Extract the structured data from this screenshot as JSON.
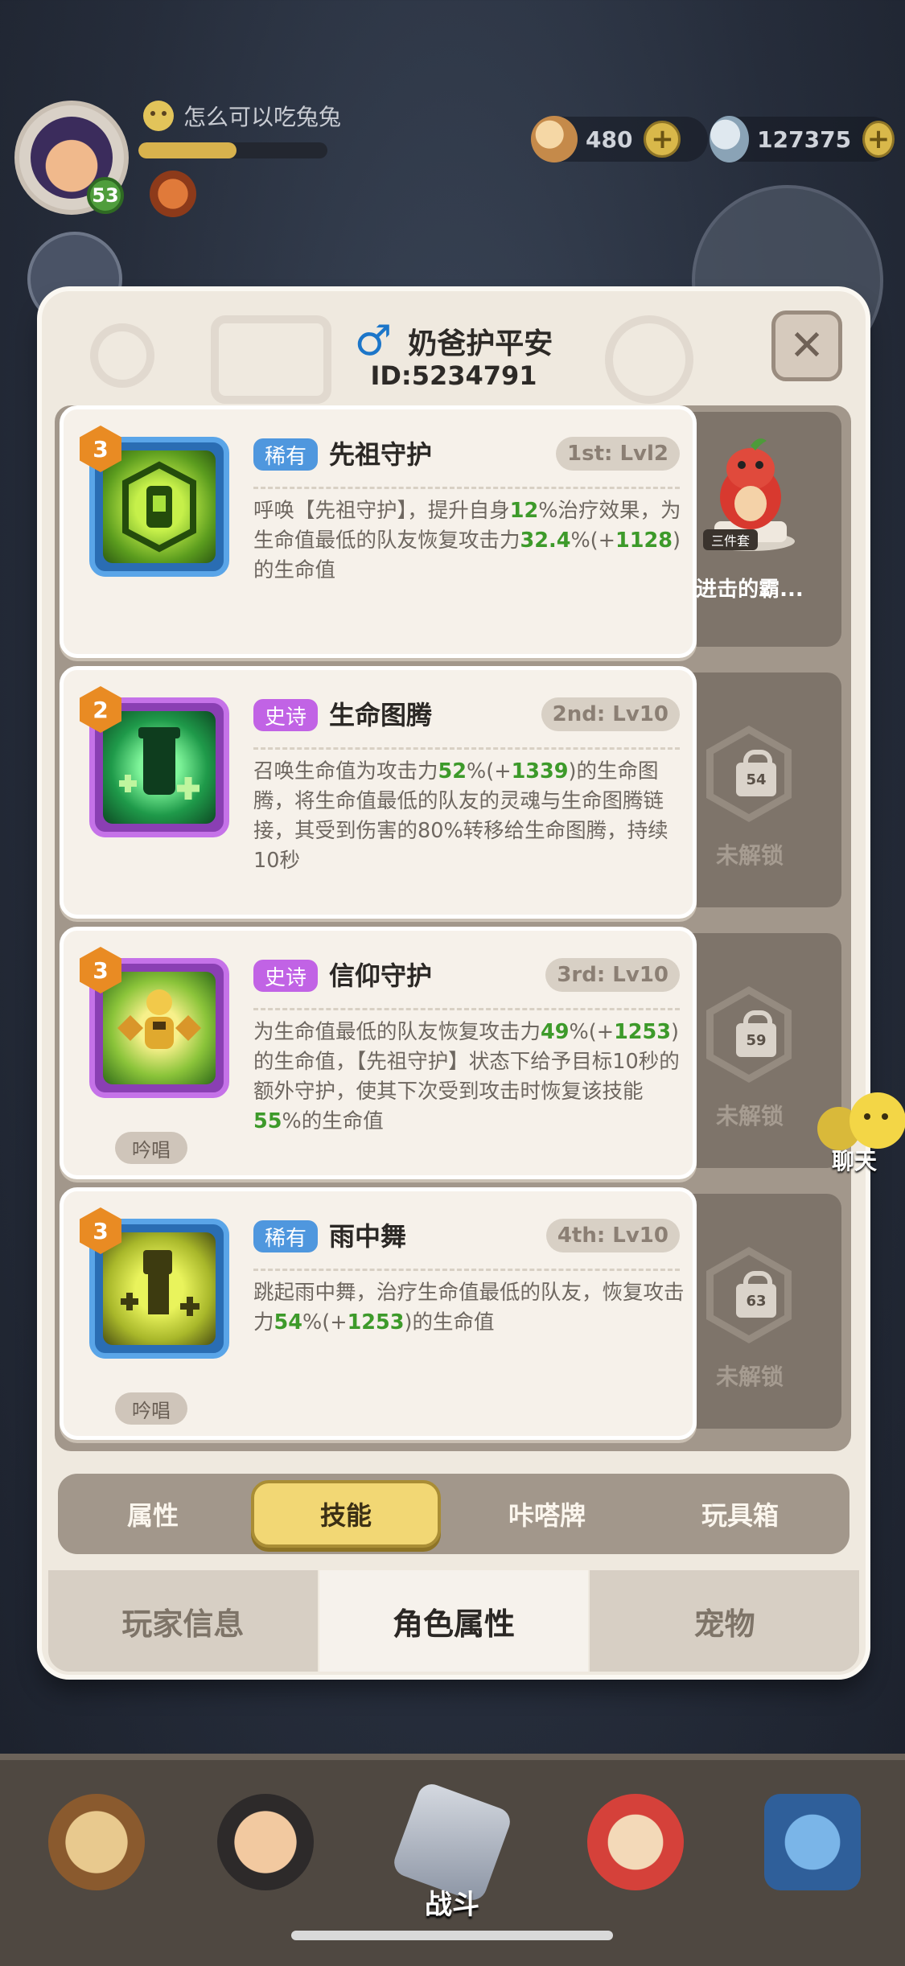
{
  "hud": {
    "username": "怎么可以吃兔兔",
    "level": "53",
    "xp_fraction": 0.52,
    "resources": [
      {
        "icon": "shell-icon",
        "value": "480"
      },
      {
        "icon": "pearl-icon",
        "value": "127375"
      }
    ],
    "plus_label": "+"
  },
  "modal": {
    "gender_icon": "♂",
    "player_name": "奶爸护平安",
    "player_id": "ID:5234791",
    "close_label": "✕",
    "set_item": {
      "badge": "三件套",
      "name": "进击的霸..."
    },
    "skills": [
      {
        "tier": "3",
        "rarity": "稀有",
        "name": "先祖守护",
        "level": "1st: Lvl2",
        "desc_html_parts": [
          [
            "t",
            "呼唤【先祖守护】，提升自身"
          ],
          [
            "g",
            "12"
          ],
          [
            "t",
            "%治疗效果，为生命值最低的队友恢复攻击力"
          ],
          [
            "g",
            "32.4"
          ],
          [
            "t",
            "%(+"
          ],
          [
            "g",
            "1128"
          ],
          [
            "t",
            ")的生命值"
          ]
        ],
        "chant": ""
      },
      {
        "tier": "2",
        "rarity": "史诗",
        "name": "生命图腾",
        "level": "2nd: Lv10",
        "desc_html_parts": [
          [
            "t",
            "召唤生命值为攻击力"
          ],
          [
            "g",
            "52"
          ],
          [
            "t",
            "%(+"
          ],
          [
            "g",
            "1339"
          ],
          [
            "t",
            ")的生命图腾，将生命值最低的队友的灵魂与生命图腾链接，其受到伤害的80%转移给生命图腾，持续10秒"
          ]
        ],
        "chant": "",
        "lock": {
          "level": "54",
          "text": "未解锁"
        }
      },
      {
        "tier": "3",
        "rarity": "史诗",
        "name": "信仰守护",
        "level": "3rd: Lv10",
        "desc_html_parts": [
          [
            "t",
            "为生命值最低的队友恢复攻击力"
          ],
          [
            "g",
            "49"
          ],
          [
            "t",
            "%(+"
          ],
          [
            "g",
            "1253"
          ],
          [
            "t",
            ")的生命值，【先祖守护】状态下给予目标10秒的额外守护，使其下次受到攻击时恢复该技能"
          ],
          [
            "g",
            "55"
          ],
          [
            "t",
            "%的生命值"
          ]
        ],
        "chant": "吟唱",
        "lock": {
          "level": "59",
          "text": "未解锁"
        }
      },
      {
        "tier": "3",
        "rarity": "稀有",
        "name": "雨中舞",
        "level": "4th: Lv10",
        "desc_html_parts": [
          [
            "t",
            "跳起雨中舞，治疗生命值最低的队友，恢复攻击力"
          ],
          [
            "g",
            "54"
          ],
          [
            "t",
            "%(+"
          ],
          [
            "g",
            "1253"
          ],
          [
            "t",
            ")的生命值"
          ]
        ],
        "chant": "吟唱",
        "lock": {
          "level": "63",
          "text": "未解锁"
        }
      }
    ],
    "inner_tabs": [
      "属性",
      "技能",
      "咔嗒牌",
      "玩具箱"
    ],
    "inner_tab_active": 1,
    "outer_tabs": [
      "玩家信息",
      "角色属性",
      "宠物"
    ],
    "outer_tab_active": 1
  },
  "chat_label": "聊天",
  "bottom_nav": {
    "battle_label": "战斗"
  },
  "colors": {
    "accent_yellow": "#f2d774",
    "number_green": "#3d9a2a",
    "rare_blue": "#4f97de",
    "epic_purple": "#c163e5"
  }
}
